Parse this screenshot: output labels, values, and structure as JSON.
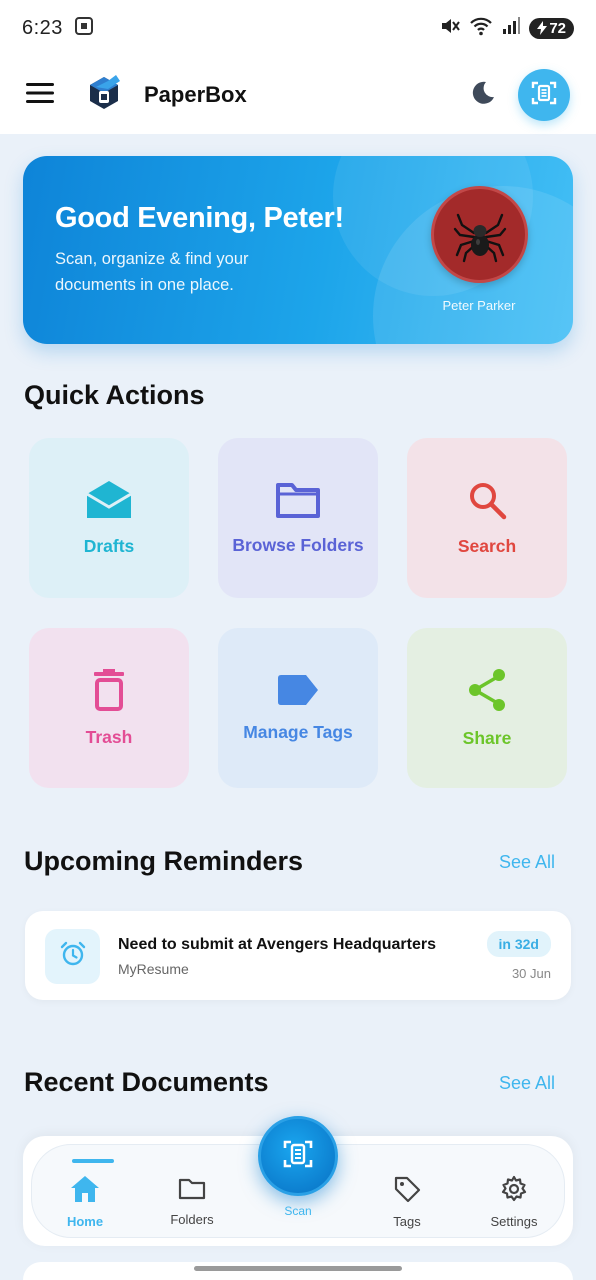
{
  "status_bar": {
    "time": "6:23",
    "battery": "72"
  },
  "header": {
    "app_name": "PaperBox",
    "icons": [
      "menu-icon",
      "app-logo",
      "moon-icon",
      "scan-icon"
    ]
  },
  "greeting": {
    "title": "Good Evening, Peter!",
    "subtitle": "Scan, organize & find your documents in one place.",
    "user_name": "Peter Parker",
    "avatar_emoji": "🕷️"
  },
  "quick_actions": {
    "title": "Quick Actions",
    "items": [
      {
        "label": "Drafts",
        "icon": "envelope-icon",
        "color": "#1fb5d2",
        "bg": "#ddf0f7"
      },
      {
        "label": "Browse Folders",
        "icon": "folder-icon",
        "color": "#5a63d6",
        "bg": "#e2e5f7"
      },
      {
        "label": "Search",
        "icon": "search-icon",
        "color": "#e0473f",
        "bg": "#f3e2e8"
      },
      {
        "label": "Trash",
        "icon": "trash-icon",
        "color": "#e34d95",
        "bg": "#f2e1ef"
      },
      {
        "label": "Manage Tags",
        "icon": "tag-icon",
        "color": "#4687e3",
        "bg": "#deeaf8"
      },
      {
        "label": "Share",
        "icon": "share-icon",
        "color": "#6cc52a",
        "bg": "#e4efe2"
      }
    ]
  },
  "reminders": {
    "title": "Upcoming Reminders",
    "see_all": "See All",
    "items": [
      {
        "title": "Need to submit at Avengers Headquarters",
        "document": "MyResume",
        "due_badge": "in 32d",
        "date": "30 Jun"
      }
    ]
  },
  "recent_documents": {
    "title": "Recent Documents",
    "see_all": "See All"
  },
  "bottom_nav": {
    "items": [
      {
        "label": "Home",
        "icon": "home-icon",
        "active": true
      },
      {
        "label": "Folders",
        "icon": "folder-icon",
        "active": false
      },
      {
        "label": "Scan",
        "icon": "scan-icon",
        "active": false
      },
      {
        "label": "Tags",
        "icon": "tag-icon",
        "active": false
      },
      {
        "label": "Settings",
        "icon": "gear-icon",
        "active": false
      }
    ]
  },
  "colors": {
    "accent": "#3fb6ee",
    "background": "#eaf1f9"
  }
}
